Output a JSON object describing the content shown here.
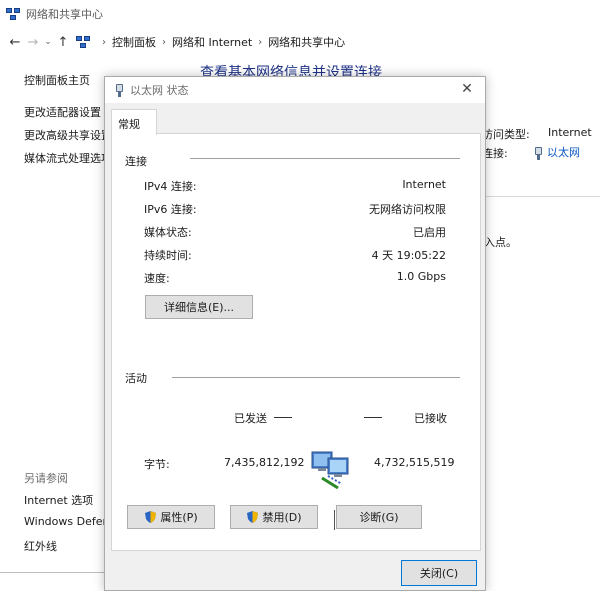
{
  "window": {
    "title": "网络和共享中心"
  },
  "nav": {
    "back": "←",
    "forward": "→",
    "recent": "⌄",
    "up": "↑"
  },
  "breadcrumb": [
    "控制面板",
    "网络和 Internet",
    "网络和共享中心"
  ],
  "left_pane": {
    "home": "控制面板主页",
    "links": [
      "更改适配器设置",
      "更改高级共享设置",
      "媒体流式处理选项"
    ],
    "see_also": "另请参阅",
    "see_also_links": [
      "Internet 选项",
      "Windows Defen",
      "红外线"
    ]
  },
  "main": {
    "heading": "查看基本网络信息并设置连接",
    "access_type_label": "访问类型:",
    "access_type_value": "Internet",
    "connection_label": "连接:",
    "connection_value": "以太网",
    "fragment": "入点。"
  },
  "dialog": {
    "title": "以太网 状态",
    "close_symbol": "✕",
    "tab": "常规",
    "connection_group": "连接",
    "rows": [
      {
        "label": "IPv4 连接:",
        "value": "Internet"
      },
      {
        "label": "IPv6 连接:",
        "value": "无网络访问权限"
      },
      {
        "label": "媒体状态:",
        "value": "已启用"
      },
      {
        "label": "持续时间:",
        "value": "4 天 19:05:22"
      },
      {
        "label": "速度:",
        "value": "1.0 Gbps"
      }
    ],
    "details_button": "详细信息(E)...",
    "activity_group": "活动",
    "sent_label": "已发送",
    "received_label": "已接收",
    "bytes_label": "字节:",
    "bytes_sent": "7,435,812,192",
    "bytes_received": "4,732,515,519",
    "properties_button": "属性(P)",
    "disable_button": "禁用(D)",
    "diagnose_button": "诊断(G)",
    "close_button": "关闭(C)"
  },
  "colors": {
    "heading": "#1e3287",
    "link": "#0b57c3",
    "dialog_bg": "#f0f0f0",
    "accent": "#0078d7"
  }
}
